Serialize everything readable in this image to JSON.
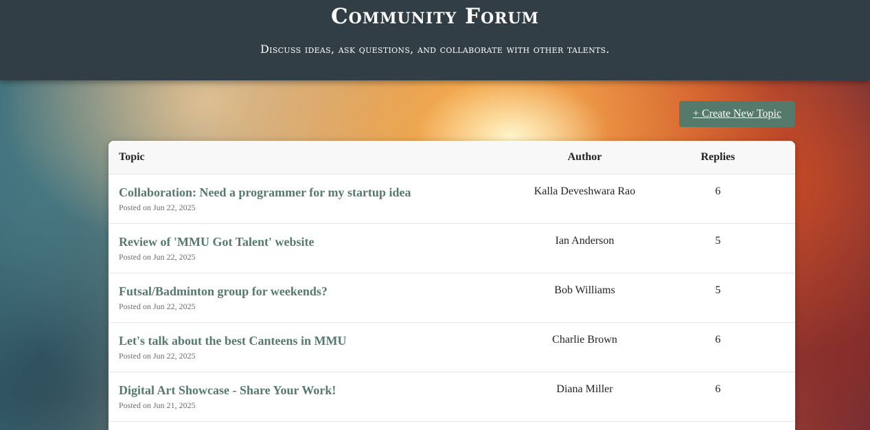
{
  "header": {
    "title": "Community Forum",
    "subtitle": "Discuss ideas, ask questions, and collaborate with other talents."
  },
  "actions": {
    "create_label": "+ Create New Topic"
  },
  "table": {
    "columns": {
      "topic": "Topic",
      "author": "Author",
      "replies": "Replies"
    },
    "rows": [
      {
        "title": "Collaboration: Need a programmer for my startup idea",
        "posted": "Posted on Jun 22, 2025",
        "author": "Kalla Deveshwara Rao",
        "replies": "6"
      },
      {
        "title": "Review of 'MMU Got Talent' website",
        "posted": "Posted on Jun 22, 2025",
        "author": "Ian Anderson",
        "replies": "5"
      },
      {
        "title": "Futsal/Badminton group for weekends?",
        "posted": "Posted on Jun 22, 2025",
        "author": "Bob Williams",
        "replies": "5"
      },
      {
        "title": "Let's talk about the best Canteens in MMU",
        "posted": "Posted on Jun 22, 2025",
        "author": "Charlie Brown",
        "replies": "6"
      },
      {
        "title": "Digital Art Showcase - Share Your Work!",
        "posted": "Posted on Jun 21, 2025",
        "author": "Diana Miller",
        "replies": "6"
      }
    ]
  },
  "colors": {
    "header_bg": "#313e45",
    "accent": "#557a6c"
  }
}
